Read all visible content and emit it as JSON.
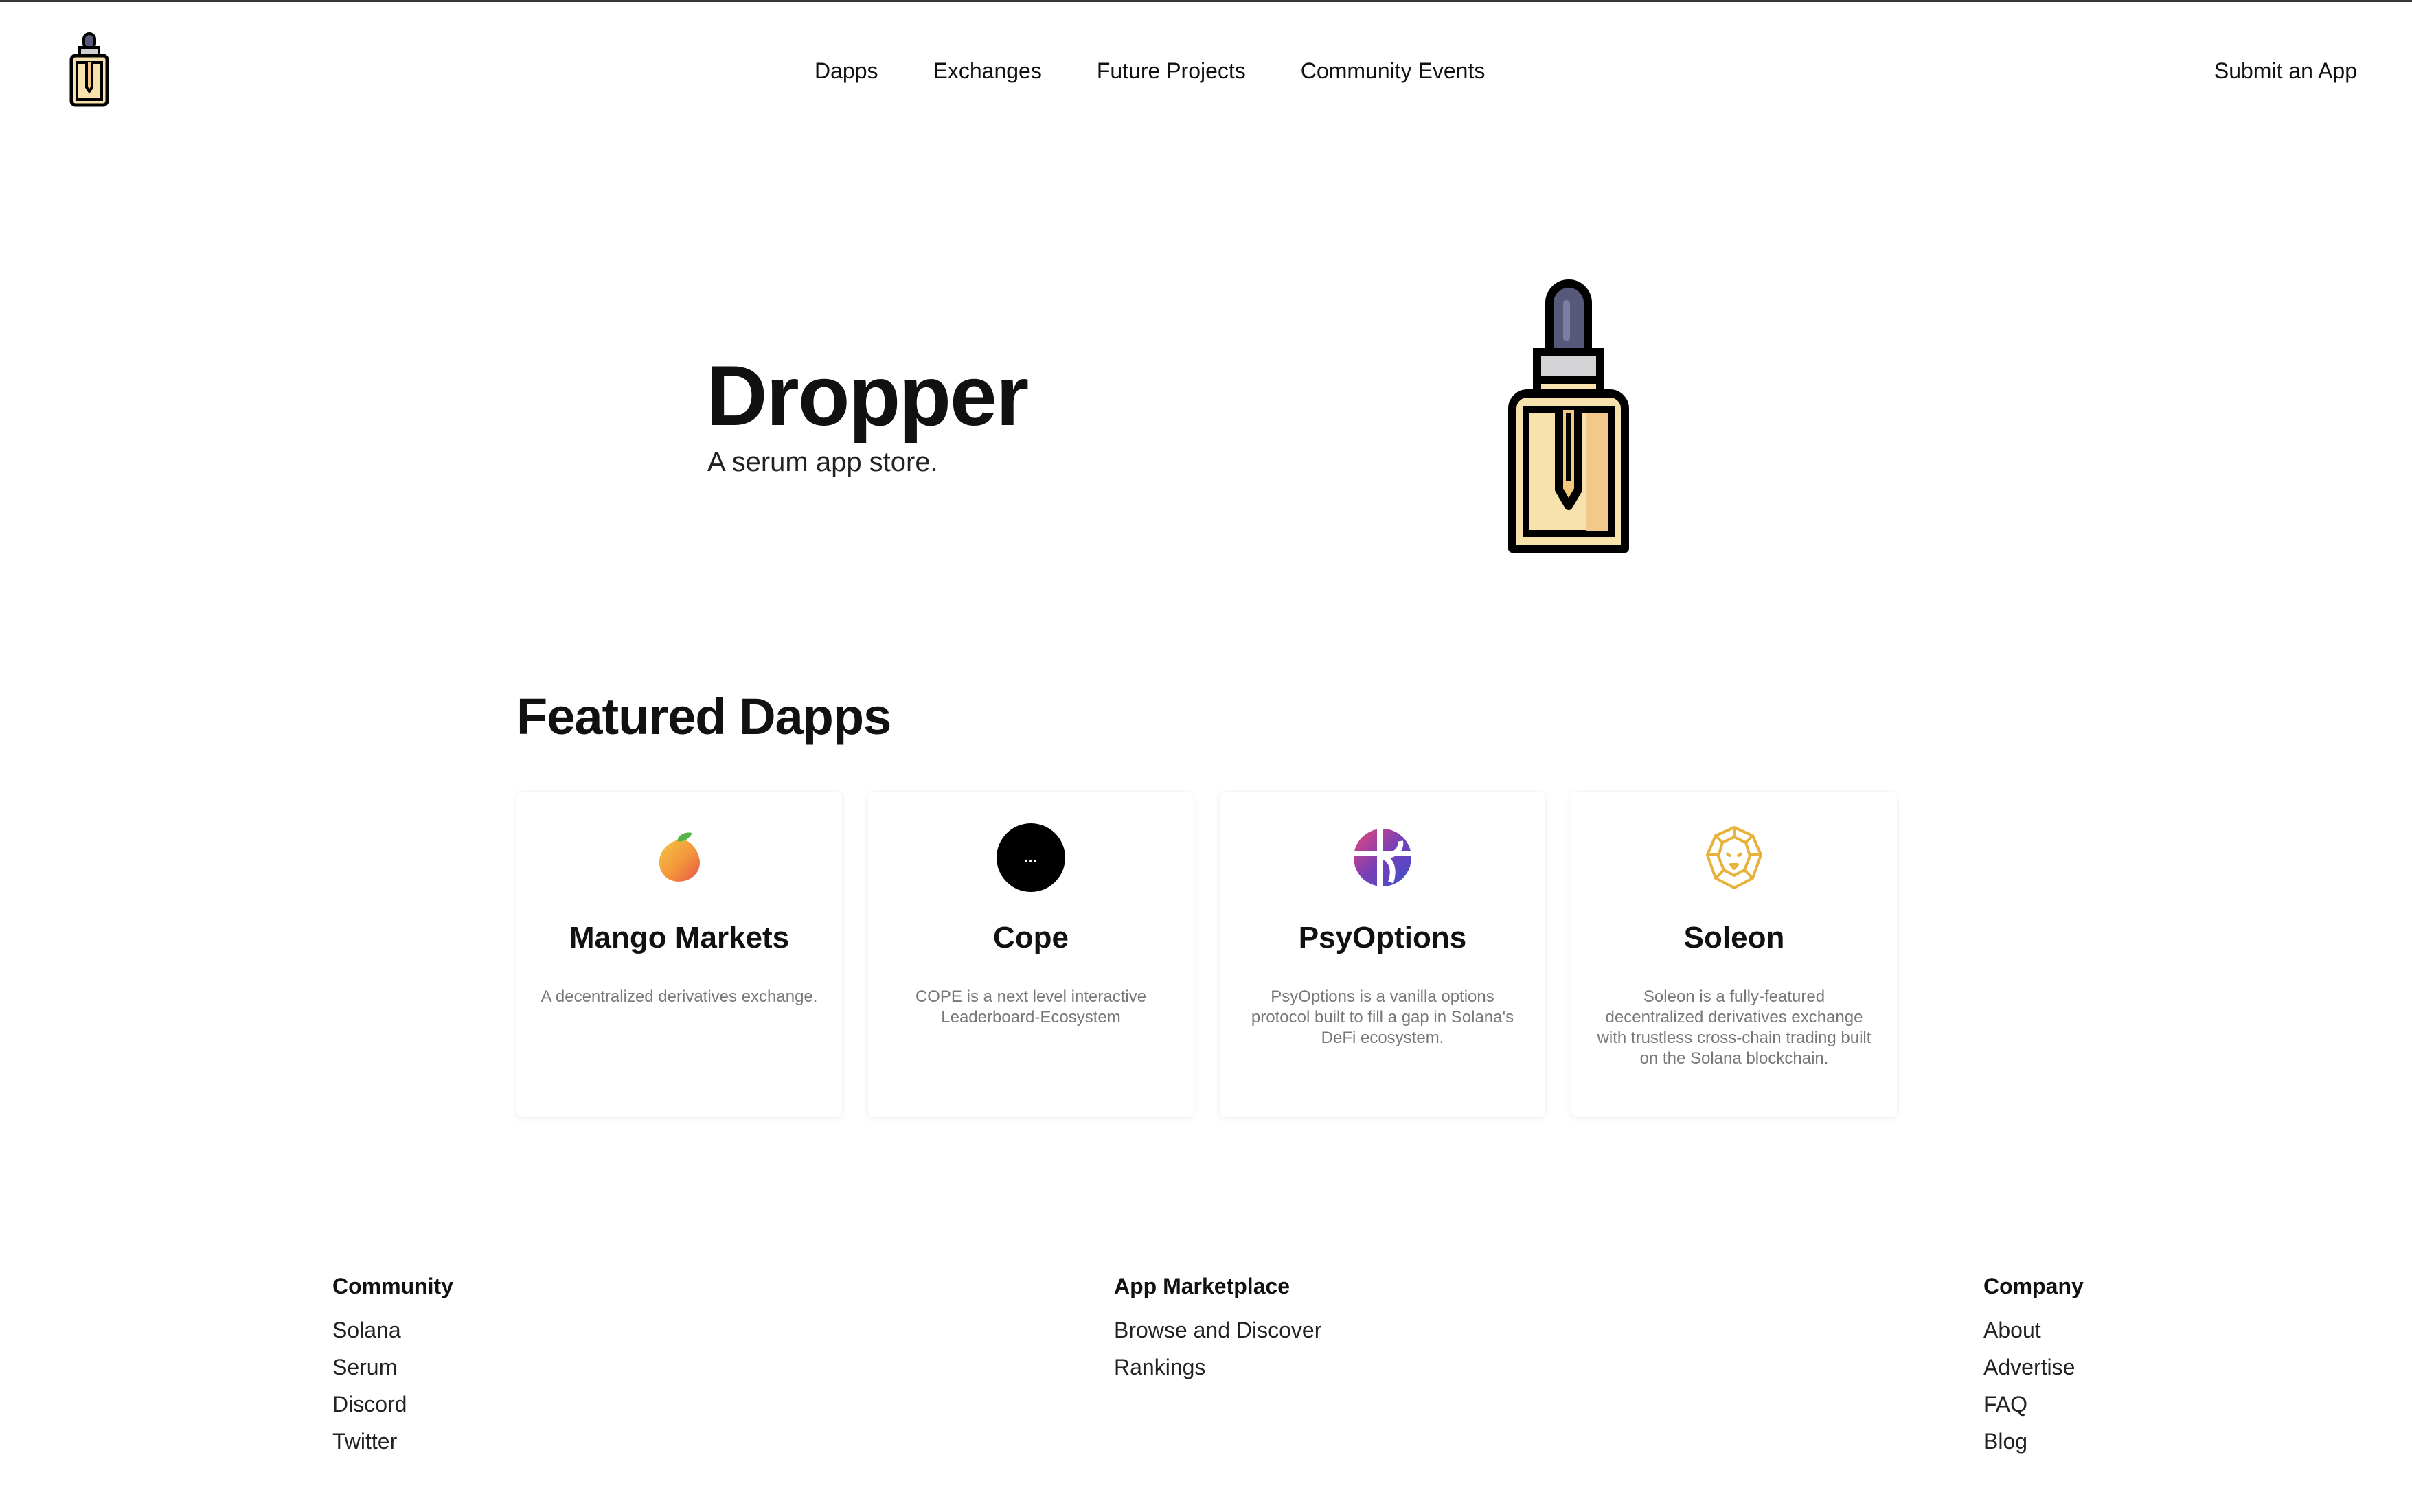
{
  "header": {
    "nav": [
      "Dapps",
      "Exchanges",
      "Future Projects",
      "Community Events"
    ],
    "submit_label": "Submit an App"
  },
  "hero": {
    "title": "Dropper",
    "subtitle": "A serum app store."
  },
  "featured": {
    "title": "Featured Dapps",
    "cards": [
      {
        "name": "Mango Markets",
        "description": "A decentralized derivatives exchange.",
        "icon": "mango-icon"
      },
      {
        "name": "Cope",
        "description": "COPE is a next level interactive Leaderboard-Ecosystem",
        "icon": "cope-icon",
        "icon_text": "..."
      },
      {
        "name": "PsyOptions",
        "description": "PsyOptions is a vanilla options protocol built to fill a gap in Solana's DeFi ecosystem.",
        "icon": "psyoptions-icon"
      },
      {
        "name": "Soleon",
        "description": "Soleon is a fully-featured decentralized derivatives exchange with trustless cross-chain trading built on the Solana blockchain.",
        "icon": "soleon-lion-icon"
      }
    ]
  },
  "footer": {
    "community": {
      "title": "Community",
      "links": [
        "Solana",
        "Serum",
        "Discord",
        "Twitter"
      ]
    },
    "marketplace": {
      "title": "App Marketplace",
      "links": [
        "Browse and Discover",
        "Rankings"
      ]
    },
    "company": {
      "title": "Company",
      "links": [
        "About",
        "Advertise",
        "FAQ",
        "Blog"
      ]
    }
  },
  "colors": {
    "text": "#111111",
    "muted": "#777777",
    "bottle_glass": "#f7e2ae",
    "bottle_cap": "#56597a",
    "mango_orange": "#f39a3c",
    "psy_purple": "#5b3bb8",
    "soleon_gold": "#e7b23a"
  }
}
